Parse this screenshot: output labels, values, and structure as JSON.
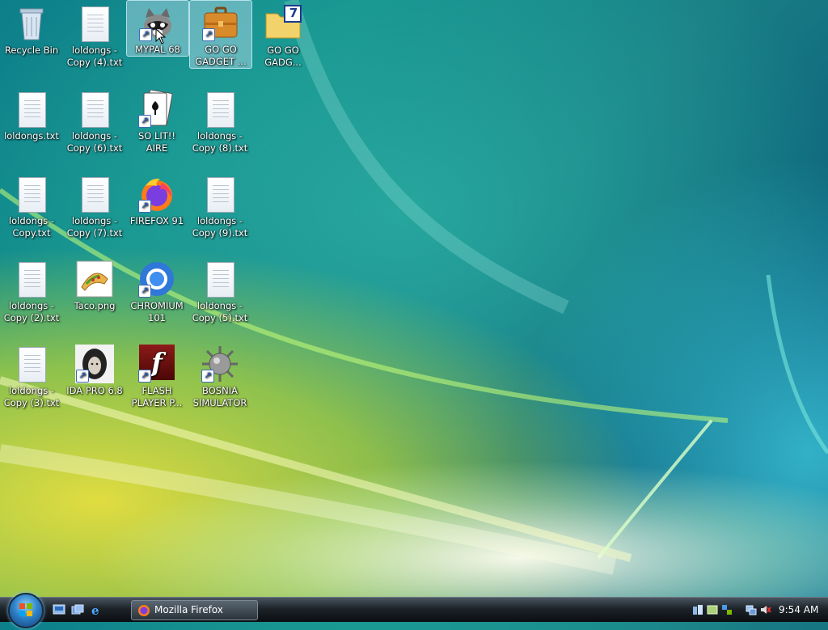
{
  "desktop": {
    "icons": [
      {
        "label": "Recycle Bin"
      },
      {
        "label": "loldongs - Copy (4).txt"
      },
      {
        "label": "MYPAL 68"
      },
      {
        "label": "GO GO GADGET ..."
      },
      {
        "label": "GO GO GADG..."
      },
      {
        "label": "loldongs.txt"
      },
      {
        "label": "loldongs - Copy (6).txt"
      },
      {
        "label": "SO LIT!! AIRE"
      },
      {
        "label": "loldongs - Copy (8).txt"
      },
      {
        "label": "loldongs - Copy.txt"
      },
      {
        "label": "loldongs - Copy (7).txt"
      },
      {
        "label": "FIREFOX 91"
      },
      {
        "label": "loldongs - Copy (9).txt"
      },
      {
        "label": "loldongs - Copy (2).txt"
      },
      {
        "label": "Taco.png"
      },
      {
        "label": "CHROMIUM 101"
      },
      {
        "label": "loldongs - Copy (5).txt"
      },
      {
        "label": "loldongs - Copy (3).txt"
      },
      {
        "label": "IDA PRO 6.8"
      },
      {
        "label": "FLASH PLAYER P..."
      },
      {
        "label": "BOSNIA SIMULATOR"
      }
    ],
    "gadget_badge": "7",
    "flash_glyph": "f"
  },
  "taskbar": {
    "task_button_label": "Mozilla Firefox",
    "clock": "9:54 AM"
  }
}
